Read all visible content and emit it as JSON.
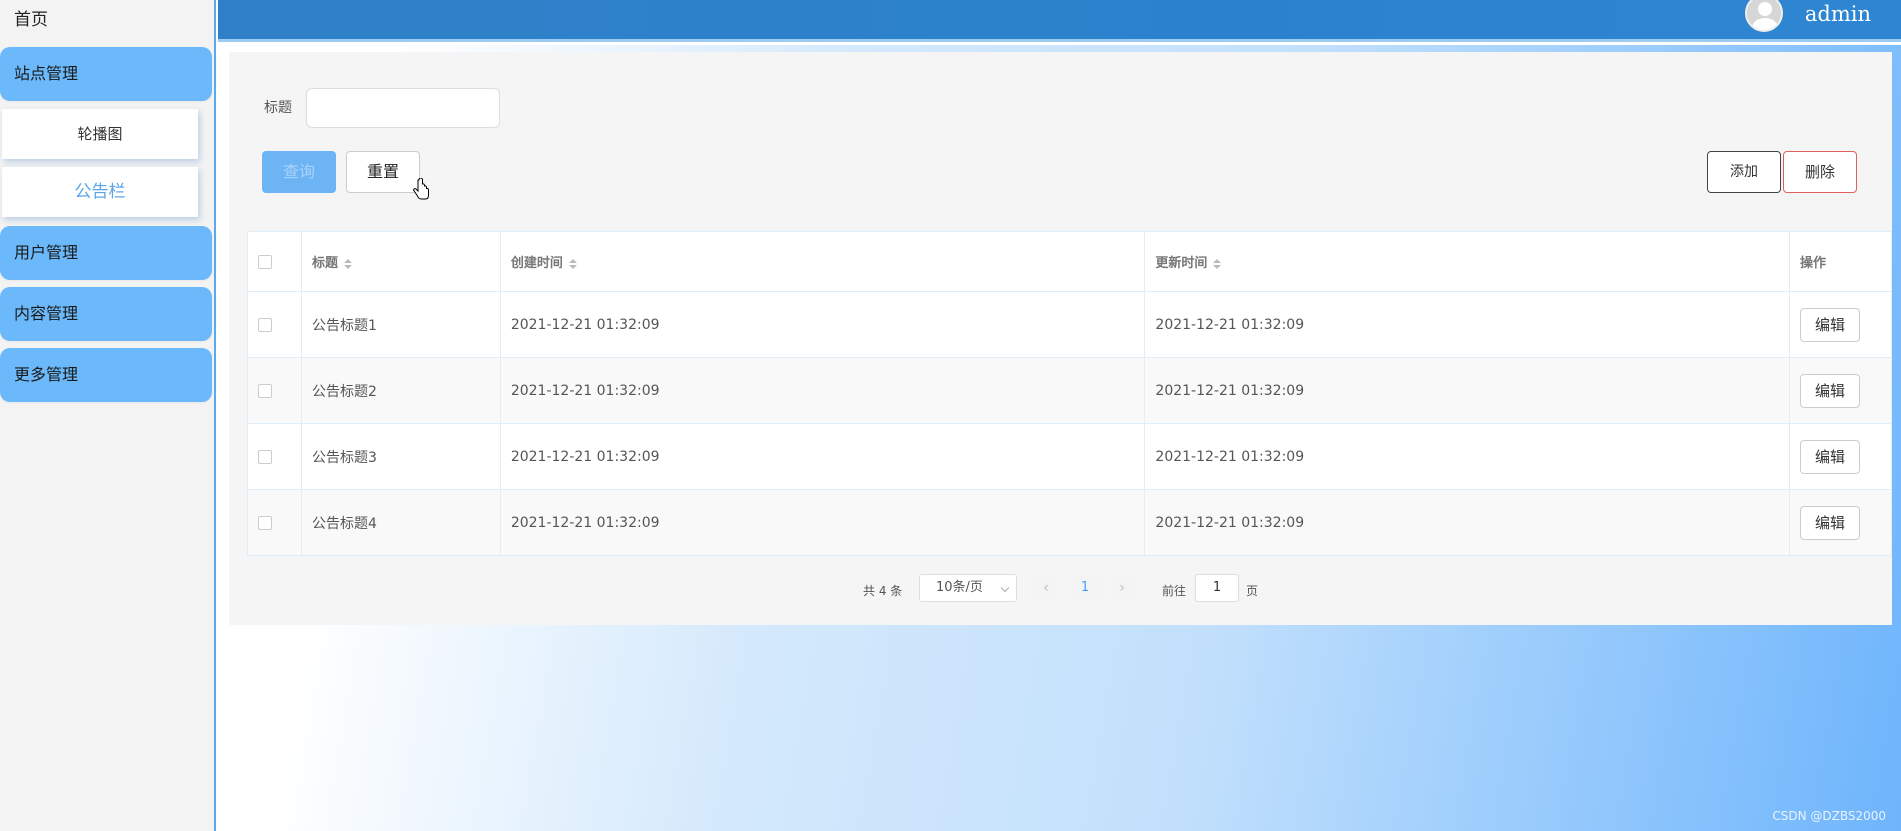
{
  "sidebar": {
    "home": "首页",
    "groups": [
      {
        "label": "站点管理"
      },
      {
        "label": "用户管理"
      },
      {
        "label": "内容管理"
      },
      {
        "label": "更多管理"
      }
    ],
    "sub_items": [
      {
        "label": "轮播图"
      },
      {
        "label": "公告栏"
      }
    ]
  },
  "header": {
    "username": "admin"
  },
  "search": {
    "title_label": "标题",
    "title_value": ""
  },
  "buttons": {
    "query": "查询",
    "reset": "重置",
    "add": "添加",
    "delete": "删除",
    "edit": "编辑"
  },
  "table": {
    "columns": [
      "标题",
      "创建时间",
      "更新时间",
      "操作"
    ],
    "rows": [
      {
        "title": "公告标题1",
        "created": "2021-12-21 01:32:09",
        "updated": "2021-12-21 01:32:09"
      },
      {
        "title": "公告标题2",
        "created": "2021-12-21 01:32:09",
        "updated": "2021-12-21 01:32:09"
      },
      {
        "title": "公告标题3",
        "created": "2021-12-21 01:32:09",
        "updated": "2021-12-21 01:32:09"
      },
      {
        "title": "公告标题4",
        "created": "2021-12-21 01:32:09",
        "updated": "2021-12-21 01:32:09"
      }
    ]
  },
  "pagination": {
    "total": "共 4 条",
    "page_size": "10条/页",
    "current_page": "1",
    "goto_label": "前往",
    "goto_value": "1",
    "page_unit": "页"
  },
  "watermark": "CSDN @DZBS2000"
}
